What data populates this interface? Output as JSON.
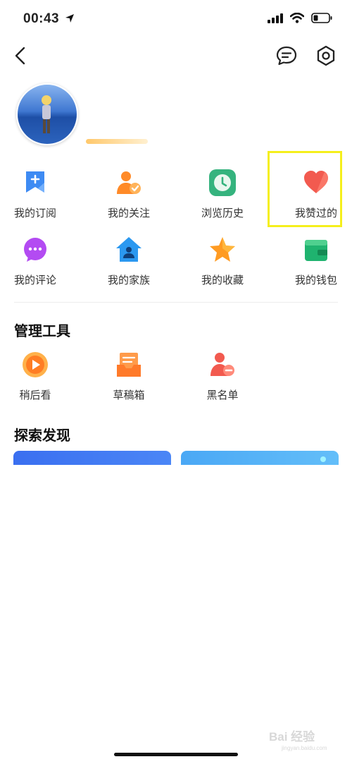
{
  "status": {
    "time": "00:43"
  },
  "grid": [
    {
      "label": "我的订阅"
    },
    {
      "label": "我的关注"
    },
    {
      "label": "浏览历史"
    },
    {
      "label": "我赞过的"
    },
    {
      "label": "我的评论"
    },
    {
      "label": "我的家族"
    },
    {
      "label": "我的收藏"
    },
    {
      "label": "我的钱包"
    }
  ],
  "tools": {
    "title": "管理工具",
    "items": [
      {
        "label": "稍后看"
      },
      {
        "label": "草稿箱"
      },
      {
        "label": "黑名单"
      }
    ]
  },
  "discover": {
    "title": "探索发现"
  },
  "watermark": {
    "text": "Bai 经验",
    "sub": "jingyan.baidu.com"
  },
  "colors": {
    "highlight": "#f5ef1c",
    "subscribe": "#3e8bf3",
    "follow": "#ff8a28",
    "history": "#35b37e",
    "like": "#f25a4f",
    "comment": "#b34bf2",
    "family": "#2b98f0",
    "collect": "#ff9b22",
    "wallet": "#1fb36f"
  }
}
